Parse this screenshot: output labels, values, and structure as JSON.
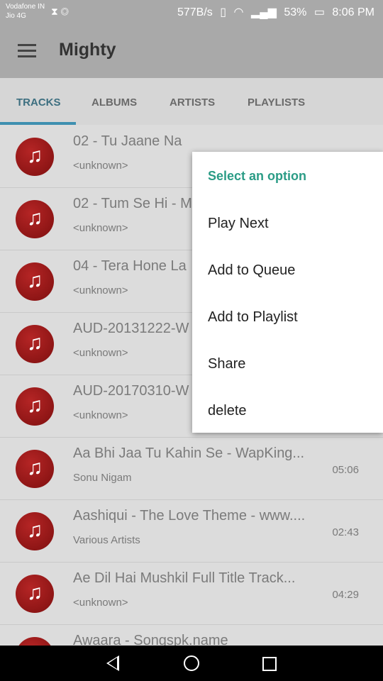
{
  "status_bar": {
    "carrier": "Vodafone IN",
    "network": "Jio 4G",
    "speed": "577B/s",
    "battery": "53%",
    "time": "8:06 PM"
  },
  "app_bar": {
    "title": "Mighty"
  },
  "tabs": [
    {
      "label": "TRACKS"
    },
    {
      "label": "ALBUMS"
    },
    {
      "label": "ARTISTS"
    },
    {
      "label": "PLAYLISTS"
    }
  ],
  "tracks": [
    {
      "title": "02 - Tu Jaane Na",
      "artist": "<unknown>",
      "duration": ""
    },
    {
      "title": "02 - Tum Se Hi - M",
      "artist": "<unknown>",
      "duration": ""
    },
    {
      "title": "04 - Tera Hone La",
      "artist": "<unknown>",
      "duration": ""
    },
    {
      "title": "AUD-20131222-W",
      "artist": "<unknown>",
      "duration": ""
    },
    {
      "title": "AUD-20170310-W",
      "artist": "<unknown>",
      "duration": ""
    },
    {
      "title": "Aa Bhi Jaa Tu Kahin Se - WapKing...",
      "artist": "Sonu Nigam",
      "duration": "05:06"
    },
    {
      "title": "Aashiqui - The Love Theme - www....",
      "artist": "Various Artists",
      "duration": "02:43"
    },
    {
      "title": "Ae Dil Hai Mushkil  Full Title Track...",
      "artist": "<unknown>",
      "duration": "04:29"
    },
    {
      "title": "Awaara - Songspk.name",
      "artist": "",
      "duration": ""
    }
  ],
  "popup": {
    "title": "Select an option",
    "items": [
      "Play Next",
      "Add to Queue",
      "Add to Playlist",
      "Share",
      "delete"
    ]
  },
  "icons": {
    "menu": "hamburger-icon",
    "track": "music-note-icon",
    "nav_back": "back-triangle-icon",
    "nav_home": "home-circle-icon",
    "nav_recent": "recent-square-icon"
  },
  "colors": {
    "accent": "#3f90b0",
    "popup_title": "#2b9c86",
    "disc": "#9e1b1b"
  }
}
